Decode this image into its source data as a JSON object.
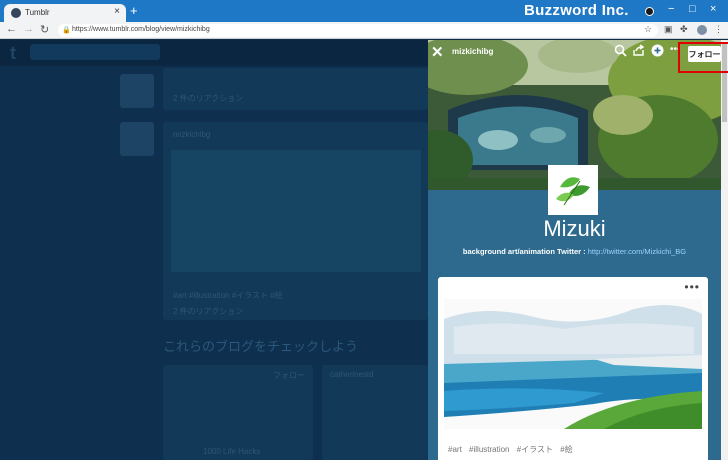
{
  "browser": {
    "tab_title": "Tumblr",
    "tab_close": "×",
    "new_tab": "+",
    "url": "https://www.tumblr.com/blog/view/mizkichibg",
    "brand_watermark": "Buzzword Inc.",
    "win_controls": [
      "−",
      "□",
      "×"
    ]
  },
  "panel": {
    "blog_name": "mizkichibg",
    "close_icon": "✕",
    "follow_label": "フォロー",
    "title": "Mizuki",
    "description_text": "background art/animation Twitter : ",
    "description_link": "http://twitter.com/Mizkichi_BG",
    "post_more": "•••",
    "tags": [
      "#art",
      "#illustration",
      "#イラスト",
      "#絵"
    ]
  },
  "dashboard": {
    "logo": "t",
    "post1_meta": "2 件のリアクション",
    "post2_author": "mizkichibg",
    "post2_tags": "#art #illustration #イラスト #絵",
    "post2_meta": "2 件のリアクション",
    "recommend_heading": "これらのブログをチェックしよう",
    "card1_title": "1000 Life Hacks",
    "card1_follow": "フォロー",
    "card2_title": "catherinestd"
  }
}
